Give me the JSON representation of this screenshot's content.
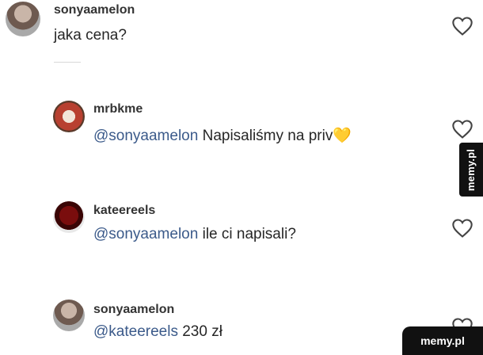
{
  "comments": [
    {
      "username": "sonyaamelon",
      "mention": "",
      "text": "jaka cena?",
      "avatar_icon": "avatar-photo-woman",
      "liked": false
    },
    {
      "username": "mrbkme",
      "mention": "@sonyaamelon",
      "text": "Napisaliśmy na priv",
      "emoji": "💛",
      "avatar_icon": "avatar-photo-logo",
      "liked": false
    },
    {
      "username": "kateereels",
      "mention": "@sonyaamelon",
      "text": "ile ci napisali?",
      "avatar_icon": "avatar-photo-red-hair",
      "liked": false
    },
    {
      "username": "sonyaamelon",
      "mention": "@kateereels",
      "text": "230 zł",
      "avatar_icon": "avatar-photo-woman",
      "liked": false
    }
  ],
  "watermark": {
    "side": "memy.pl",
    "corner": "memy.pl"
  },
  "colors": {
    "mention": "#3b5a8a",
    "text": "#262626",
    "username": "#333333",
    "watermark_bg": "#111111"
  }
}
